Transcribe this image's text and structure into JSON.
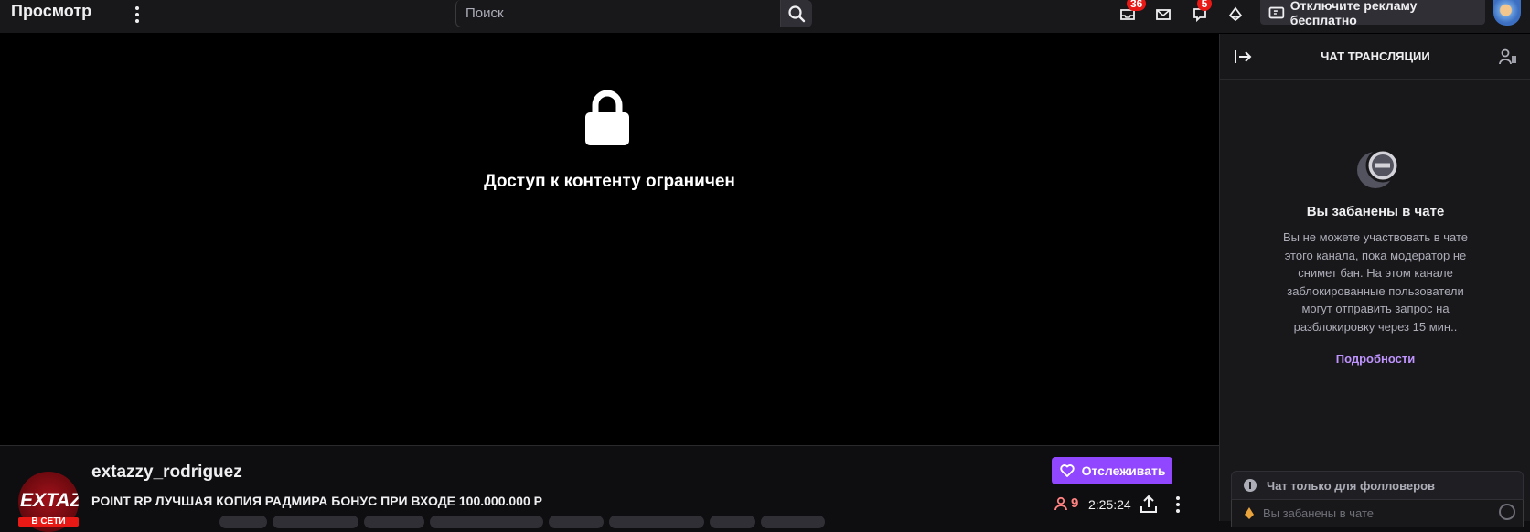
{
  "topbar": {
    "brand": "Просмотр",
    "search_placeholder": "Поиск",
    "inbox_badge": "36",
    "notifications_badge": "5",
    "ad_button_label": "Отключите рекламу бесплатно"
  },
  "player": {
    "restricted_text": "Доступ к контенту ограничен"
  },
  "channel": {
    "name": "extazzy_rodriguez",
    "avatar_text": "EXTAZZ",
    "live_label": "В СЕТИ",
    "title": "POINT RP ЛУЧШАЯ КОПИЯ РАДМИРА БОНУС ПРИ ВХОДЕ 100.000.000 Р",
    "follow_label": "Отслеживать",
    "viewers": "9",
    "uptime": "2:25:24"
  },
  "chat": {
    "header_title": "ЧАТ ТРАНСЛЯЦИИ",
    "ban_title": "Вы забанены в чате",
    "ban_text": "Вы не можете участвовать в чате этого канала, пока модератор не снимет бан. На этом канале заблокированные пользователи могут отправить запрос на разблокировку через 15 мин..",
    "details_link": "Подробности",
    "followers_only": "Чат только для фолловеров",
    "input_placeholder": "Вы забанены в чате"
  },
  "colors": {
    "accent": "#9147ff",
    "link": "#bf94ff",
    "badge": "#e91916",
    "viewers": "#ff8280"
  }
}
